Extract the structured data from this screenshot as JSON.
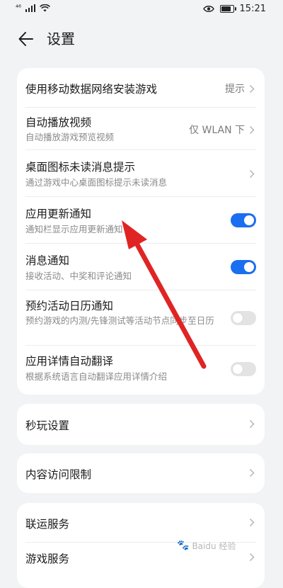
{
  "status_bar": {
    "signal": "⁴⁶",
    "time": "15:21"
  },
  "header": {
    "title": "设置"
  },
  "main_settings": [
    {
      "title": "使用移动数据网络安装游戏",
      "value": "提示"
    },
    {
      "title": "自动播放视频",
      "subtitle": "自动播放游戏预览视频",
      "value": "仅 WLAN 下"
    },
    {
      "title": "桌面图标未读消息提示",
      "subtitle": "通过游戏中心桌面图标提示未读消息"
    },
    {
      "title": "应用更新通知",
      "subtitle": "通知栏显示应用更新通知",
      "toggle": true
    },
    {
      "title": "消息通知",
      "subtitle": "接收活动、中奖和评论通知",
      "toggle": true
    },
    {
      "title": "预约活动日历通知",
      "subtitle": "预约游戏的内测/先锋测试等活动节点同步至日历",
      "toggle": false
    },
    {
      "title": "应用详情自动翻译",
      "subtitle": "根据系统语言自动翻译应用详情介绍",
      "toggle": false
    }
  ],
  "quick_play": {
    "title": "秒玩设置"
  },
  "content_limit": {
    "title": "内容访问限制"
  },
  "services": [
    {
      "title": "联运服务"
    },
    {
      "title": "游戏服务"
    }
  ],
  "watermark": {
    "text": "Baidu 经验"
  },
  "colors": {
    "accent": "#1a6ef0",
    "arrow": "#e02424",
    "background": "#f1f3f5"
  }
}
